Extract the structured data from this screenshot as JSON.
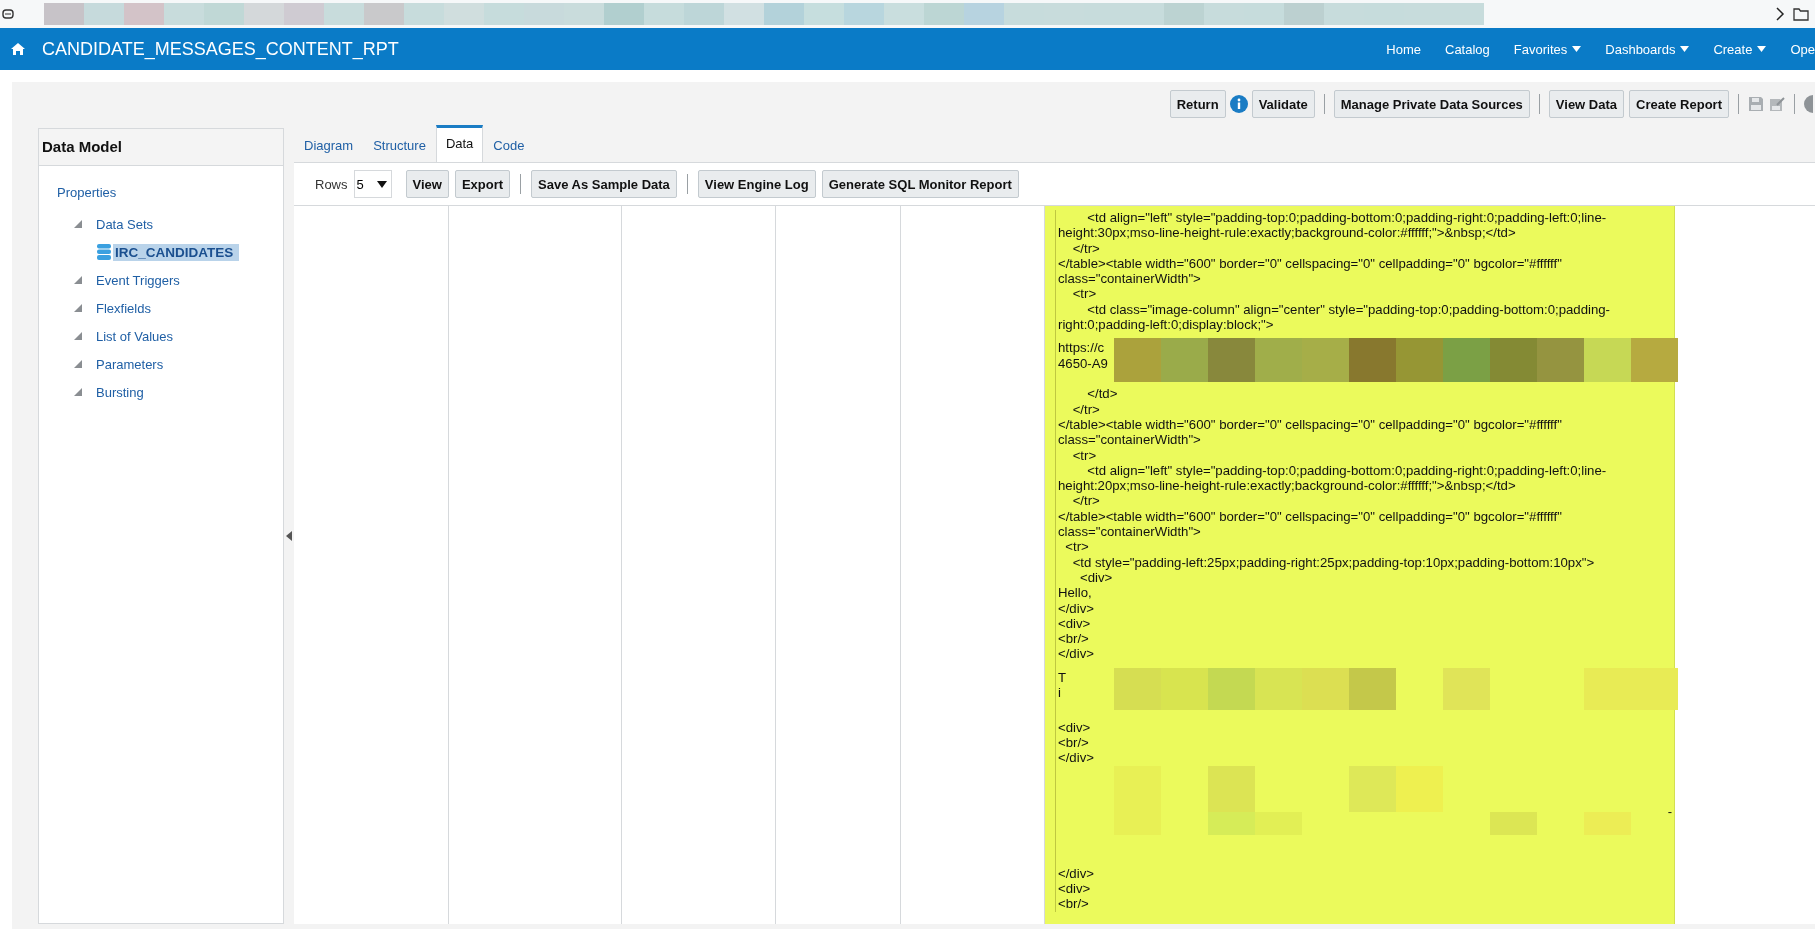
{
  "header": {
    "title": "CANDIDATE_MESSAGES_CONTENT_RPT",
    "nav": [
      {
        "label": "Home",
        "menu": false
      },
      {
        "label": "Catalog",
        "menu": false
      },
      {
        "label": "Favorites",
        "menu": true
      },
      {
        "label": "Dashboards",
        "menu": true
      },
      {
        "label": "Create",
        "menu": true
      },
      {
        "label": "Ope",
        "menu": false
      }
    ]
  },
  "toolbar": {
    "groups": [
      [
        "Return",
        "Validate"
      ],
      [
        "Manage Private Data Sources"
      ],
      [
        "View Data",
        "Create Report"
      ]
    ]
  },
  "sidebar": {
    "title": "Data Model",
    "tree": [
      {
        "label": "Properties",
        "selected": false,
        "children": [
          {
            "label": "Data Sets",
            "selected": false,
            "expanded": true,
            "children": [
              {
                "label": "IRC_CANDIDATES",
                "selected": true,
                "kind": "dataset"
              }
            ]
          },
          {
            "label": "Event Triggers",
            "selected": false,
            "expanded": true
          },
          {
            "label": "Flexfields",
            "selected": false,
            "expanded": true
          },
          {
            "label": "List of Values",
            "selected": false,
            "expanded": true
          },
          {
            "label": "Parameters",
            "selected": false,
            "expanded": true
          },
          {
            "label": "Bursting",
            "selected": false,
            "expanded": true
          }
        ]
      }
    ]
  },
  "tabs": [
    {
      "label": "Diagram",
      "selected": false
    },
    {
      "label": "Structure",
      "selected": false
    },
    {
      "label": "Data",
      "selected": true
    },
    {
      "label": "Code",
      "selected": false
    }
  ],
  "data_toolbar": {
    "rows_label": "Rows",
    "rows_value": "5",
    "groups": [
      [
        "View",
        "Export"
      ],
      [
        "Save As Sample Data"
      ],
      [
        "View Engine Log",
        "Generate SQL Monitor Report"
      ]
    ]
  },
  "code_lines": [
    {
      "kind": "line",
      "text": "        <td align=\"left\" style=\"padding-top:0;padding-bottom:0;padding-right:0;padding-left:0;line-"
    },
    {
      "kind": "line",
      "text": "height:30px;mso-line-height-rule:exactly;background-color:#ffffff;\">&nbsp;</td>"
    },
    {
      "kind": "line",
      "text": "    </tr>"
    },
    {
      "kind": "line",
      "text": "</table><table width=\"600\" border=\"0\" cellspacing=\"0\" cellpadding=\"0\" bgcolor=\"#ffffff\""
    },
    {
      "kind": "line",
      "text": "class=\"containerWidth\">"
    },
    {
      "kind": "line",
      "text": "    <tr>"
    },
    {
      "kind": "line",
      "text": "        <td class=\"image-column\" align=\"center\" style=\"padding-top:0;padding-bottom:0;padding-"
    },
    {
      "kind": "line",
      "text": "right:0;padding-left:0;display:block;\">"
    },
    {
      "kind": "masked",
      "lines": [
        "https://c",
        "4650-A9"
      ]
    },
    {
      "kind": "line",
      "text": "        </td>"
    },
    {
      "kind": "line",
      "text": "    </tr>"
    },
    {
      "kind": "line",
      "text": "</table><table width=\"600\" border=\"0\" cellspacing=\"0\" cellpadding=\"0\" bgcolor=\"#ffffff\""
    },
    {
      "kind": "line",
      "text": "class=\"containerWidth\">"
    },
    {
      "kind": "line",
      "text": "    <tr>"
    },
    {
      "kind": "line",
      "text": "        <td align=\"left\" style=\"padding-top:0;padding-bottom:0;padding-right:0;padding-left:0;line-"
    },
    {
      "kind": "line",
      "text": "height:20px;mso-line-height-rule:exactly;background-color:#ffffff;\">&nbsp;</td>"
    },
    {
      "kind": "line",
      "text": "    </tr>"
    },
    {
      "kind": "line",
      "text": "</table><table width=\"600\" border=\"0\" cellspacing=\"0\" cellpadding=\"0\" bgcolor=\"#ffffff\""
    },
    {
      "kind": "line",
      "text": "class=\"containerWidth\">"
    },
    {
      "kind": "line",
      "text": "  <tr>"
    },
    {
      "kind": "line",
      "text": "    <td style=\"padding-left:25px;padding-right:25px;padding-top:10px;padding-bottom:10px\">"
    },
    {
      "kind": "line",
      "text": "      <div>"
    },
    {
      "kind": "line",
      "text": "Hello,"
    },
    {
      "kind": "line",
      "text": "</div>"
    },
    {
      "kind": "line",
      "text": "<div>"
    },
    {
      "kind": "line",
      "text": "<br/>"
    },
    {
      "kind": "line",
      "text": "</div>"
    },
    {
      "kind": "masked",
      "lines": [
        "T",
        "i"
      ]
    },
    {
      "kind": "line",
      "text": "<div>"
    },
    {
      "kind": "line",
      "text": "<br/>"
    },
    {
      "kind": "line",
      "text": "</div>"
    },
    {
      "kind": "masked",
      "tail": "-"
    },
    {
      "kind": "line",
      "text": "</div>"
    },
    {
      "kind": "line",
      "text": "<div>"
    },
    {
      "kind": "line",
      "text": "<br/>"
    }
  ]
}
